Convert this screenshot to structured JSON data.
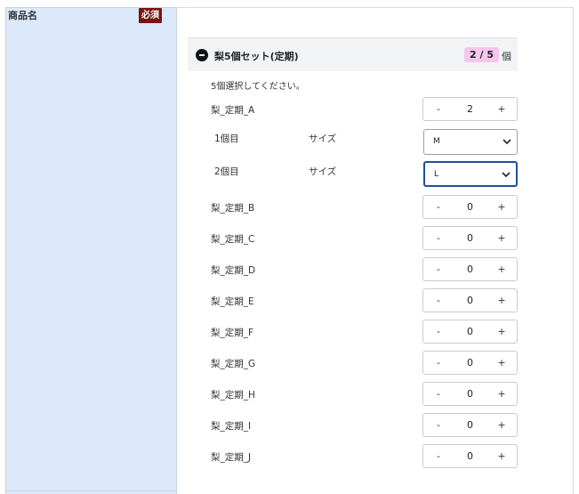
{
  "field": {
    "label": "商品名",
    "required_badge": "必須"
  },
  "set": {
    "title": "梨5個セット(定期)",
    "count_text": "2 / 5",
    "count_unit": "個",
    "instruction": "5個選択してください。"
  },
  "items": [
    {
      "label": "梨_定期_A",
      "qty": "2",
      "dec": "-",
      "inc": "+"
    },
    {
      "label": "梨_定期_B",
      "qty": "0",
      "dec": "-",
      "inc": "+"
    },
    {
      "label": "梨_定期_C",
      "qty": "0",
      "dec": "-",
      "inc": "+"
    },
    {
      "label": "梨_定期_D",
      "qty": "0",
      "dec": "-",
      "inc": "+"
    },
    {
      "label": "梨_定期_E",
      "qty": "0",
      "dec": "-",
      "inc": "+"
    },
    {
      "label": "梨_定期_F",
      "qty": "0",
      "dec": "-",
      "inc": "+"
    },
    {
      "label": "梨_定期_G",
      "qty": "0",
      "dec": "-",
      "inc": "+"
    },
    {
      "label": "梨_定期_H",
      "qty": "0",
      "dec": "-",
      "inc": "+"
    },
    {
      "label": "梨_定期_I",
      "qty": "0",
      "dec": "-",
      "inc": "+"
    },
    {
      "label": "梨_定期_J",
      "qty": "0",
      "dec": "-",
      "inc": "+"
    }
  ],
  "variants": [
    {
      "index_label": "1個目",
      "attr_label": "サイズ",
      "selected": "M"
    },
    {
      "index_label": "2個目",
      "attr_label": "サイズ",
      "selected": "L"
    }
  ],
  "icons": {
    "collapse": "minus-circle-icon",
    "dropdown": "chevron-down-icon"
  }
}
